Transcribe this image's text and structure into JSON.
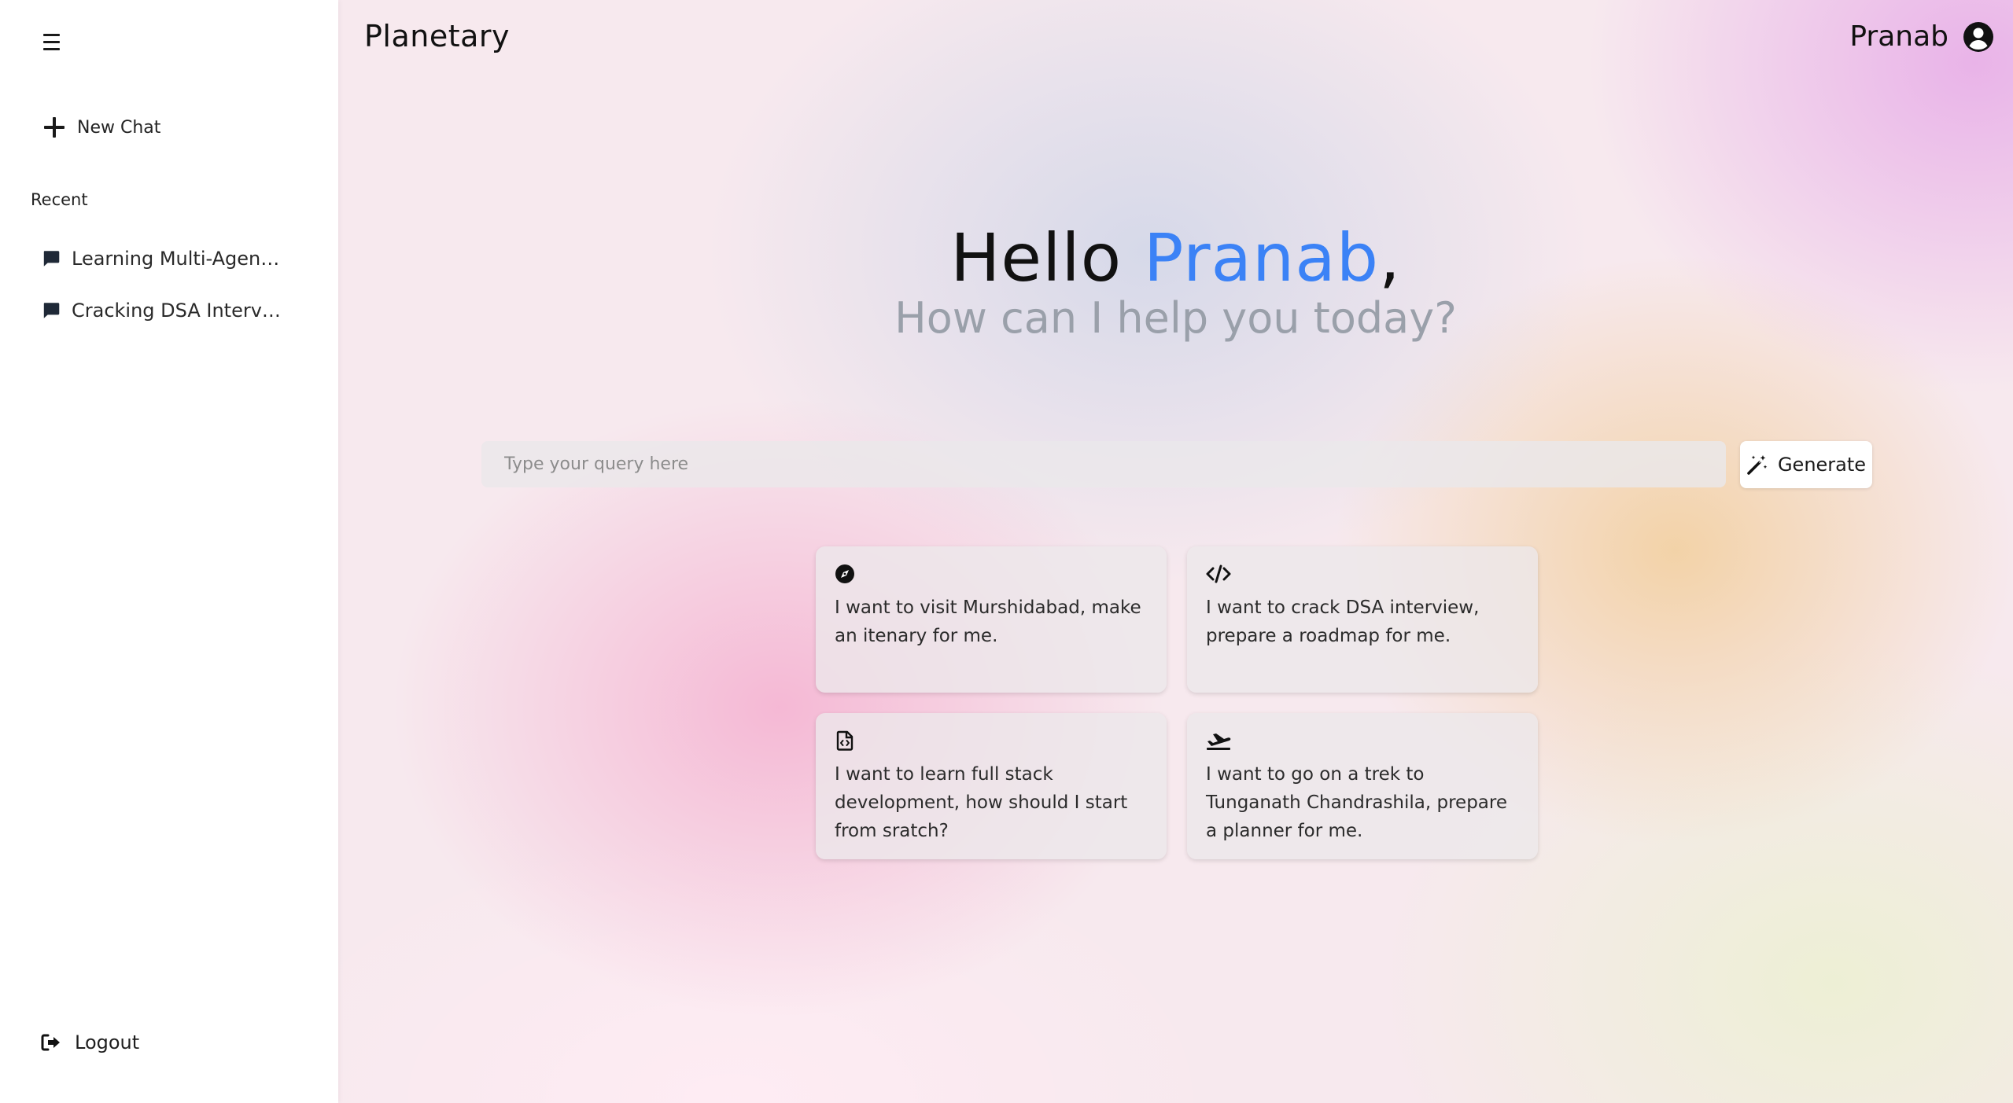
{
  "sidebar": {
    "menu_icon": "hamburger-icon",
    "new_chat_label": "New Chat",
    "recent_label": "Recent",
    "history": [
      {
        "label": "Learning Multi-Agent...",
        "icon": "chat-bubble-icon"
      },
      {
        "label": "Cracking DSA Intervie...",
        "icon": "chat-bubble-icon"
      }
    ],
    "logout_label": "Logout"
  },
  "header": {
    "app_title": "Planetary",
    "user_name": "Pranab",
    "user_icon": "user-circle-icon"
  },
  "greeting": {
    "hello": "Hello",
    "name": "Pranab",
    "comma": ",",
    "subtitle": "How can I help you today?"
  },
  "query": {
    "placeholder": "Type your query here",
    "value": "",
    "generate_label": "Generate"
  },
  "suggestions": [
    {
      "icon": "compass-icon",
      "text": "I want to visit Murshidabad, make an itenary for me."
    },
    {
      "icon": "code-icon",
      "text": "I want to crack DSA interview, prepare a roadmap for me."
    },
    {
      "icon": "code-file-icon",
      "text": "I want to learn full stack development, how should I start from sratch?"
    },
    {
      "icon": "plane-departure-icon",
      "text": "I want to go on a trek to Tunganath Chandrashila, prepare a planner for me."
    }
  ],
  "colors": {
    "accent": "#3b82f6",
    "subtitle": "#9aa0aa",
    "sidebar_bg": "#ffffff"
  }
}
